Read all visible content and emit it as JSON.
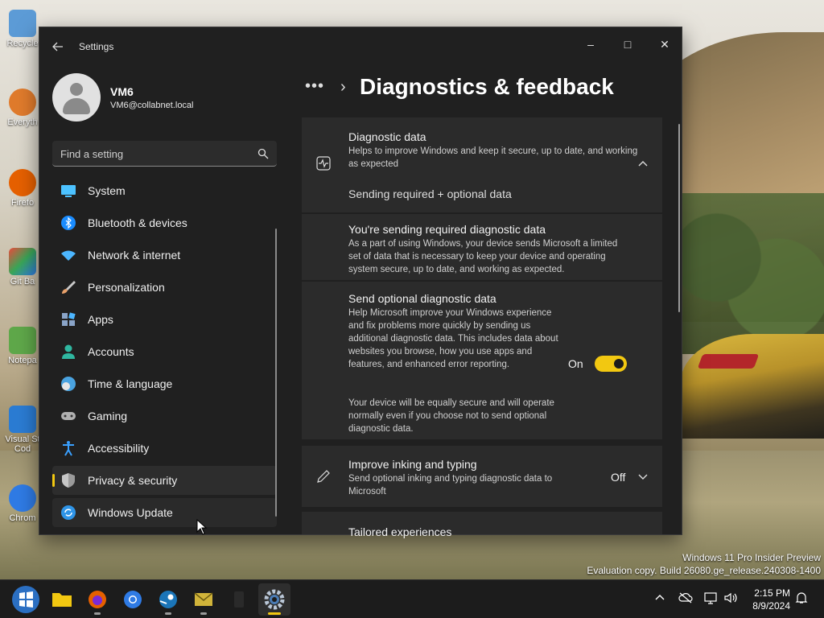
{
  "desktop": {
    "icons": [
      {
        "label": "Recycle",
        "color": "#4a90d9"
      },
      {
        "label": "Everyth",
        "color": "#e07b2c"
      },
      {
        "label": "Firefo",
        "color": "#e66000"
      },
      {
        "label": "Git Ba",
        "color": "#3aa657"
      },
      {
        "label": "Notepa",
        "color": "#5fa84a"
      },
      {
        "label": "Visual St Cod",
        "color": "#2b7cd3"
      },
      {
        "label": "Chrom",
        "color": "#2f7be5"
      }
    ],
    "watermark": {
      "line1": "Windows 11 Pro Insider Preview",
      "line2": "Evaluation copy. Build 26080.ge_release.240308-1400"
    }
  },
  "window": {
    "title": "Settings",
    "controls": {
      "minimize": "–",
      "maximize": "□",
      "close": "✕"
    }
  },
  "user": {
    "name": "VM6",
    "email": "VM6@collabnet.local"
  },
  "search": {
    "placeholder": "Find a setting"
  },
  "nav": [
    {
      "label": "System",
      "icon": "monitor-icon",
      "color": "#4cc2ff"
    },
    {
      "label": "Bluetooth & devices",
      "icon": "bluetooth-icon",
      "color": "#1a8cff"
    },
    {
      "label": "Network & internet",
      "icon": "wifi-icon",
      "color": "#4cb6ff"
    },
    {
      "label": "Personalization",
      "icon": "brush-icon",
      "color": "#e8a06a"
    },
    {
      "label": "Apps",
      "icon": "apps-icon",
      "color": "#8aa4c8"
    },
    {
      "label": "Accounts",
      "icon": "person-icon",
      "color": "#2fb7a0"
    },
    {
      "label": "Time & language",
      "icon": "globe-clock-icon",
      "color": "#4aa3e0"
    },
    {
      "label": "Gaming",
      "icon": "controller-icon",
      "color": "#b0b0b0"
    },
    {
      "label": "Accessibility",
      "icon": "accessibility-icon",
      "color": "#3aa0ff"
    },
    {
      "label": "Privacy & security",
      "icon": "shield-icon",
      "color": "#9a9a9a"
    },
    {
      "label": "Windows Update",
      "icon": "update-icon",
      "color": "#2f95e8"
    }
  ],
  "breadcrumb": {
    "more": "•••",
    "separator": "›"
  },
  "page_title": "Diagnostics & feedback",
  "diagnostic": {
    "title": "Diagnostic data",
    "desc": "Helps to improve Windows and keep it secure, up to date, and working as expected",
    "status": "Sending required + optional data",
    "required_title": "You're sending required diagnostic data",
    "required_desc": "As a part of using Windows, your device sends Microsoft a limited set of data that is necessary to keep your device and operating system secure, up to date, and working as expected.",
    "optional_title": "Send optional diagnostic data",
    "optional_desc": "Help Microsoft improve your Windows experience and fix problems more quickly by sending us additional diagnostic data. This includes data about websites you browse, how you use apps and features, and enhanced error reporting.",
    "optional_note": "Your device will be equally secure and will operate normally even if you choose not to send optional diagnostic data.",
    "optional_state": "On"
  },
  "inking": {
    "title": "Improve inking and typing",
    "desc": "Send optional inking and typing diagnostic data to Microsoft",
    "state": "Off"
  },
  "tailored": {
    "title": "Tailored experiences"
  },
  "taskbar": {
    "apps": [
      "start-icon",
      "file-explorer-icon",
      "firefox-icon",
      "chrome-icon",
      "steam-icon",
      "mail-icon",
      "terminal-icon",
      "settings-icon"
    ],
    "time": "2:15 PM",
    "date": "8/9/2024"
  },
  "colors": {
    "accent": "#f2c811",
    "window_bg": "#202020",
    "panel_bg": "#2b2b2b"
  }
}
